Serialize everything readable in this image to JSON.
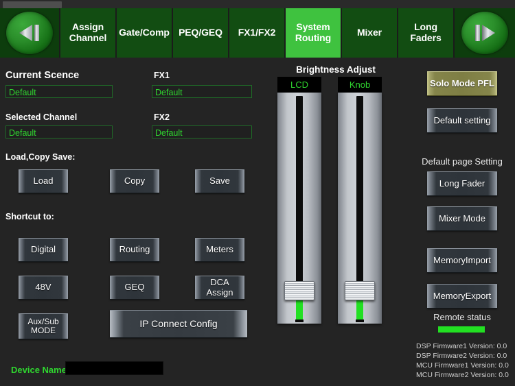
{
  "window": {
    "tab_placeholder": ""
  },
  "nav": {
    "prev_icon": "skip-back-icon",
    "next_icon": "skip-forward-icon",
    "tabs": [
      {
        "label": "Assign\nChannel",
        "active": false
      },
      {
        "label": "Gate/Comp",
        "active": false
      },
      {
        "label": "PEQ/GEQ",
        "active": false
      },
      {
        "label": "FX1/FX2",
        "active": false
      },
      {
        "label": "System\nRouting",
        "active": true
      },
      {
        "label": "Mixer",
        "active": false
      },
      {
        "label": "Long\nFaders",
        "active": false
      }
    ]
  },
  "left": {
    "current_scene_label": "Current Scence",
    "current_scene_value": "Default",
    "selected_channel_label": "Selected Channel",
    "selected_channel_value": "Default",
    "fx1_label": "FX1",
    "fx1_value": "Default",
    "fx2_label": "FX2",
    "fx2_value": "Default",
    "load_copy_save_label": "Load,Copy Save:",
    "load_label": "Load",
    "copy_label": "Copy",
    "save_label": "Save",
    "shortcut_label": "Shortcut to:",
    "digital_label": "Digital",
    "routing_label": "Routing",
    "meters_label": "Meters",
    "phantom_label": "48V",
    "geq_label": "GEQ",
    "dca_assign_label": "DCA\nAssign",
    "aux_sub_label": "Aux/Sub\nMODE",
    "ip_connect_label": "IP Connect Config",
    "device_name_label": "Device Name:",
    "device_name_value": ""
  },
  "middle": {
    "title": "Brightness Adjust",
    "sliders": [
      {
        "cap": "LCD",
        "value_pct": 8
      },
      {
        "cap": "Knob",
        "value_pct": 8
      }
    ]
  },
  "right": {
    "solo_mode_label": "Solo Mode PFL",
    "default_setting_label": "Default setting",
    "default_page_setting_label": "Default page Setting",
    "long_fader_label": "Long Fader",
    "mixer_mode_label": "Mixer Mode",
    "memory_import_label": "MemoryImport",
    "memory_export_label": "MemoryExport",
    "remote_status_label": "Remote status",
    "firmware": [
      "DSP Firmware1 Version: 0.0",
      "DSP Firmware2 Version: 0.0",
      "MCU Firmware1 Version: 0.0",
      "MCU Firmware2 Version: 0.0"
    ]
  },
  "colors": {
    "accent_green": "#3fc23f",
    "tab_green": "#124d12",
    "text_green": "#2fd62f",
    "olive": "#85854a",
    "panel_bg": "#242424"
  }
}
